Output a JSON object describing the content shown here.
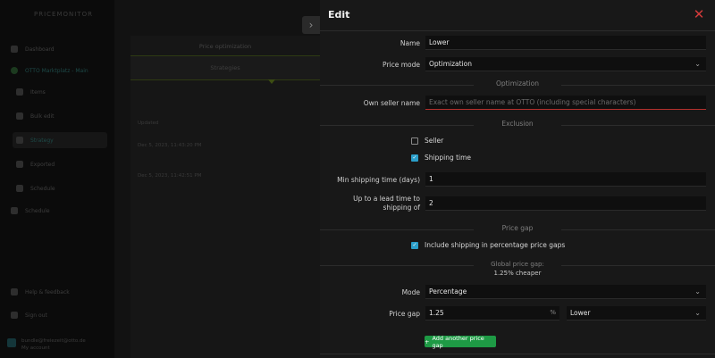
{
  "background": {
    "logo": "PRICEMONITOR",
    "nav": [
      {
        "label": "Dashboard",
        "icon": "grid-icon"
      },
      {
        "label": "OTTO Marktplatz - Main",
        "icon": "shop-icon"
      },
      {
        "label": "Items",
        "icon": "box-icon"
      },
      {
        "label": "Bulk edit",
        "icon": "edit-icon"
      },
      {
        "label": "Strategy",
        "icon": "filter-icon"
      },
      {
        "label": "Exported",
        "icon": "file-icon"
      },
      {
        "label": "Schedule",
        "icon": "calendar-icon"
      },
      {
        "label": "Schedule",
        "icon": "calendar-icon"
      }
    ],
    "help": "Help & feedback",
    "signout": "Sign out",
    "user_email": "bundle@freiezeit@otto.de",
    "user_role": "My account",
    "card_title": "Price optimization",
    "strip_label": "Strategies",
    "column_header": "Updated",
    "rows": [
      "Dec 5, 2023, 11:43:20 PM",
      "Dec 5, 2023, 11:42:51 PM"
    ]
  },
  "drawer": {
    "title": "Edit",
    "close_icon": "close-icon",
    "name_label": "Name",
    "name_value": "Lower",
    "price_mode_label": "Price mode",
    "price_mode_value": "Optimization",
    "section_optimization": "Optimization",
    "own_seller_label": "Own seller name",
    "own_seller_placeholder": "Exact own seller name at OTTO (including special characters)",
    "section_exclusion": "Exclusion",
    "seller_label": "Seller",
    "seller_checked": false,
    "shipping_time_label": "Shipping time",
    "shipping_time_checked": true,
    "min_shipping_label": "Min shipping time (days)",
    "min_shipping_value": "1",
    "lead_time_label": "Up to a lead time to shipping of",
    "lead_time_value": "2",
    "section_price_gap": "Price gap",
    "include_shipping_label": "Include shipping in percentage price gaps",
    "include_shipping_checked": true,
    "global_gap_title": "Global price gap:",
    "global_gap_value": "1.25% cheaper",
    "mode_label": "Mode",
    "mode_value": "Percentage",
    "price_gap_label": "Price gap",
    "price_gap_value": "1.25",
    "price_gap_unit": "%",
    "direction_value": "Lower",
    "add_button": "Add another price gap"
  },
  "colors": {
    "accent": "#2a9ec9",
    "danger": "#d23a3a",
    "success": "#1e9a45"
  }
}
